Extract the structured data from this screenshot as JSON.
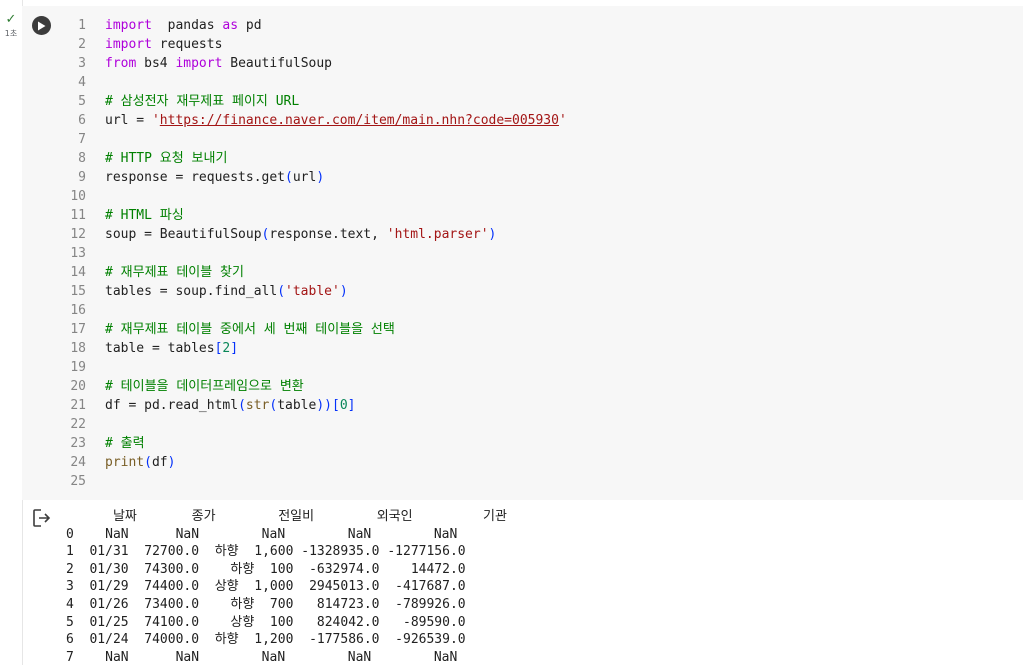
{
  "cell": {
    "status": {
      "icon": "check-icon",
      "exec_time": "1초"
    },
    "run_button_icon": "play-icon",
    "code_lines": [
      {
        "n": "1",
        "parts": [
          [
            "kw",
            "import"
          ],
          [
            "",
            "  pandas "
          ],
          [
            "kw",
            "as"
          ],
          [
            "",
            " pd"
          ]
        ]
      },
      {
        "n": "2",
        "parts": [
          [
            "kw",
            "import"
          ],
          [
            "",
            " requests"
          ]
        ]
      },
      {
        "n": "3",
        "parts": [
          [
            "kw",
            "from"
          ],
          [
            "",
            " bs4 "
          ],
          [
            "kw",
            "import"
          ],
          [
            "",
            " BeautifulSoup"
          ]
        ]
      },
      {
        "n": "4",
        "parts": []
      },
      {
        "n": "5",
        "parts": [
          [
            "cm",
            "# 삼성전자 재무제표 페이지 URL"
          ]
        ]
      },
      {
        "n": "6",
        "parts": [
          [
            "",
            "url = "
          ],
          [
            "st",
            "'"
          ],
          [
            "url",
            "https://finance.naver.com/item/main.nhn?code=005930"
          ],
          [
            "st",
            "'"
          ]
        ]
      },
      {
        "n": "7",
        "parts": []
      },
      {
        "n": "8",
        "parts": [
          [
            "cm",
            "# HTTP 요청 보내기"
          ]
        ]
      },
      {
        "n": "9",
        "parts": [
          [
            "",
            "response = requests.get"
          ],
          [
            "br",
            "("
          ],
          [
            "",
            "url"
          ],
          [
            "br",
            ")"
          ]
        ]
      },
      {
        "n": "10",
        "parts": []
      },
      {
        "n": "11",
        "parts": [
          [
            "cm",
            "# HTML 파싱"
          ]
        ]
      },
      {
        "n": "12",
        "parts": [
          [
            "",
            "soup = BeautifulSoup"
          ],
          [
            "br",
            "("
          ],
          [
            "",
            "response.text, "
          ],
          [
            "st",
            "'html.parser'"
          ],
          [
            "br",
            ")"
          ]
        ]
      },
      {
        "n": "13",
        "parts": []
      },
      {
        "n": "14",
        "parts": [
          [
            "cm",
            "# 재무제표 테이블 찾기"
          ]
        ]
      },
      {
        "n": "15",
        "parts": [
          [
            "",
            "tables = soup.find_all"
          ],
          [
            "br",
            "("
          ],
          [
            "st",
            "'table'"
          ],
          [
            "br",
            ")"
          ]
        ]
      },
      {
        "n": "16",
        "parts": []
      },
      {
        "n": "17",
        "parts": [
          [
            "cm",
            "# 재무제표 테이블 중에서 세 번째 테이블을 선택"
          ]
        ]
      },
      {
        "n": "18",
        "parts": [
          [
            "",
            "table = tables"
          ],
          [
            "br",
            "["
          ],
          [
            "num",
            "2"
          ],
          [
            "br",
            "]"
          ]
        ]
      },
      {
        "n": "19",
        "parts": []
      },
      {
        "n": "20",
        "parts": [
          [
            "cm",
            "# 테이블을 데이터프레임으로 변환"
          ]
        ]
      },
      {
        "n": "21",
        "parts": [
          [
            "",
            "df = pd.read_html"
          ],
          [
            "br",
            "("
          ],
          [
            "bi",
            "str"
          ],
          [
            "br",
            "("
          ],
          [
            "",
            "table"
          ],
          [
            "br",
            "))["
          ],
          [
            "num",
            "0"
          ],
          [
            "br",
            "]"
          ]
        ]
      },
      {
        "n": "22",
        "parts": []
      },
      {
        "n": "23",
        "parts": [
          [
            "cm",
            "# 출력"
          ]
        ]
      },
      {
        "n": "24",
        "parts": [
          [
            "bi",
            "print"
          ],
          [
            "br",
            "("
          ],
          [
            "",
            "df"
          ],
          [
            "br",
            ")"
          ]
        ]
      },
      {
        "n": "25",
        "parts": []
      }
    ]
  },
  "output": {
    "icon": "output-exit-icon",
    "lines": [
      "      날짜       종가        전일비        외국인         기관",
      "0    NaN      NaN        NaN        NaN        NaN",
      "1  01/31  72700.0  하향  1,600 -1328935.0 -1277156.0",
      "2  01/30  74300.0    하향  100  -632974.0    14472.0",
      "3  01/29  74400.0  상향  1,000  2945013.0  -417687.0",
      "4  01/26  73400.0    하향  700   814723.0  -789926.0",
      "5  01/25  74100.0    상향  100   824042.0   -89590.0",
      "6  01/24  74000.0  하향  1,200  -177586.0  -926539.0",
      "7    NaN      NaN        NaN        NaN        NaN"
    ]
  }
}
